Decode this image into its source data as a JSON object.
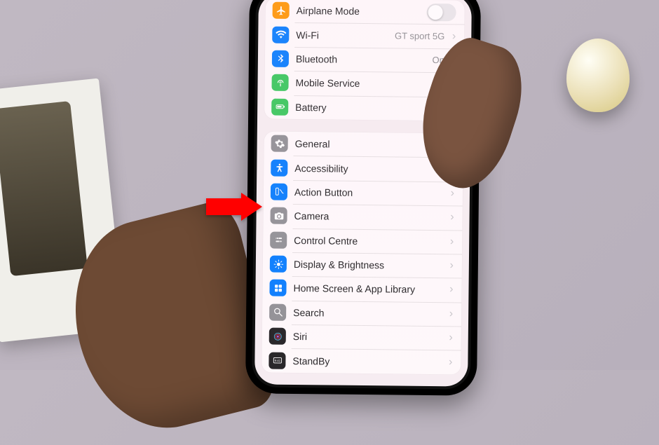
{
  "group1": {
    "airplane": {
      "label": "Airplane Mode",
      "toggle": false
    },
    "wifi": {
      "label": "Wi-Fi",
      "value": "GT sport 5G"
    },
    "bluetooth": {
      "label": "Bluetooth",
      "value": "On"
    },
    "mobile": {
      "label": "Mobile Service"
    },
    "battery": {
      "label": "Battery"
    }
  },
  "group2": {
    "general": {
      "label": "General"
    },
    "accessibility": {
      "label": "Accessibility"
    },
    "action_button": {
      "label": "Action Button"
    },
    "camera": {
      "label": "Camera"
    },
    "control_centre": {
      "label": "Control Centre"
    },
    "display": {
      "label": "Display & Brightness"
    },
    "home_screen": {
      "label": "Home Screen & App Library"
    },
    "search": {
      "label": "Search"
    },
    "siri": {
      "label": "Siri"
    },
    "standby": {
      "label": "StandBy"
    }
  },
  "annotation": {
    "points_to": "action-button-row",
    "color": "#ff0000"
  }
}
